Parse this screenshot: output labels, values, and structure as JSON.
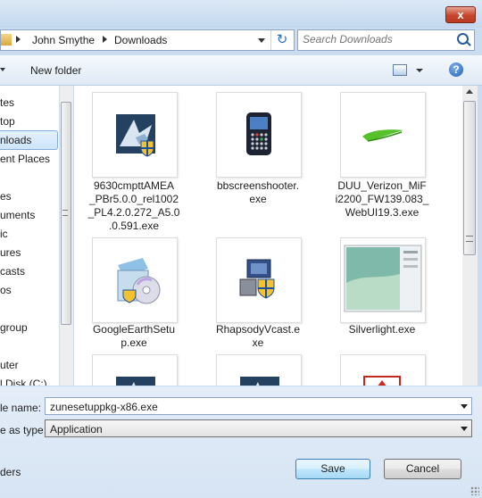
{
  "window": {
    "close_label": "x"
  },
  "address": {
    "crumbs": [
      "John Smythe",
      "Downloads"
    ]
  },
  "search": {
    "placeholder": "Search Downloads"
  },
  "toolbar": {
    "new_folder_label": "New folder",
    "help_label": "?"
  },
  "nav": {
    "items": [
      {
        "label": "tes",
        "selected": false
      },
      {
        "label": "top",
        "selected": false
      },
      {
        "label": "nloads",
        "selected": true
      },
      {
        "label": "ent Places",
        "selected": false
      },
      {
        "label": "es",
        "selected": false
      },
      {
        "label": "uments",
        "selected": false
      },
      {
        "label": "ic",
        "selected": false
      },
      {
        "label": "ures",
        "selected": false
      },
      {
        "label": "casts",
        "selected": false
      },
      {
        "label": "os",
        "selected": false
      },
      {
        "label": "group",
        "selected": false
      },
      {
        "label": "uter",
        "selected": false
      },
      {
        "label": "l Disk (C:)",
        "selected": false
      }
    ]
  },
  "files": [
    {
      "lines": [
        "9630cmpttAMEA",
        "_PBr5.0.0_rel1002",
        "_PL4.2.0.272_A5.0",
        ".0.591.exe"
      ],
      "icon": "installer-shield-icon"
    },
    {
      "lines": [
        "bbscreenshooter.",
        "exe"
      ],
      "icon": "blackberry-phone-icon"
    },
    {
      "lines": [
        "DUU_Verizon_MiF",
        "i2200_FW139.083_",
        "WebUI19.3.exe"
      ],
      "icon": "verizon-check-icon"
    },
    {
      "lines": [
        "GoogleEarthSetu",
        "p.exe"
      ],
      "icon": "setup-disc-icon"
    },
    {
      "lines": [
        "RhapsodyVcast.e",
        "xe"
      ],
      "icon": "installer-computer-shield-icon"
    },
    {
      "lines": [
        "Silverlight.exe"
      ],
      "icon": "silverlight-window-icon"
    },
    {
      "lines": [],
      "icon": "installer-shield-icon"
    },
    {
      "lines": [],
      "icon": "installer-shield-icon"
    },
    {
      "lines": [],
      "icon": "red-document-icon"
    }
  ],
  "form": {
    "filename_label": "le name:",
    "filename_value": "zunesetuppkg-x86.exe",
    "type_label": "e as type:",
    "type_value": "Application",
    "folders_label": "ders",
    "save_label": "Save",
    "cancel_label": "Cancel"
  },
  "colors": {
    "accent": "#3c7fb1",
    "selection": "#cde4f9",
    "frame": "#c9dcf0"
  }
}
